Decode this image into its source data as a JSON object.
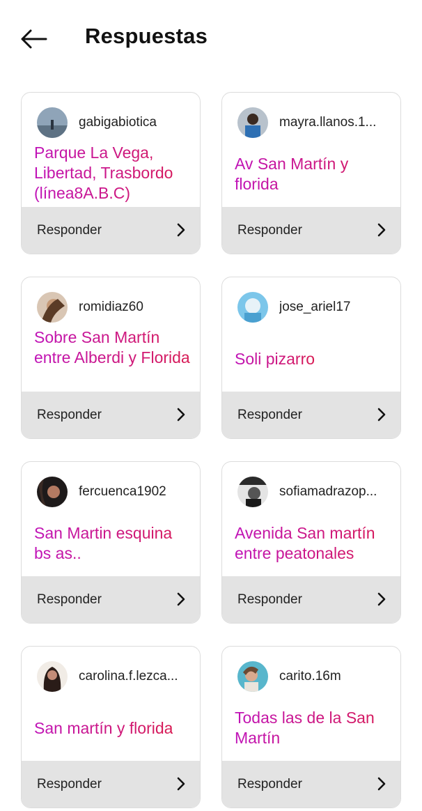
{
  "header": {
    "title": "Respuestas"
  },
  "reply_label": "Responder",
  "cards": [
    {
      "username": "gabigabiotica",
      "answer": "Parque La Vega, Libertad, Trasbordo (línea8A.B.C)"
    },
    {
      "username": "mayra.llanos.1...",
      "answer": "Av San Martín y florida"
    },
    {
      "username": "romidiaz60",
      "answer": "Sobre San Martín entre Alberdi y Florida"
    },
    {
      "username": "jose_ariel17",
      "answer": "Soli pizarro"
    },
    {
      "username": "fercuenca1902",
      "answer": "San Martin esquina bs as.."
    },
    {
      "username": "sofiamadrazop...",
      "answer": "Avenida San martín entre peatonales"
    },
    {
      "username": "carolina.f.lezca...",
      "answer": "San martín y florida"
    },
    {
      "username": "carito.16m",
      "answer": "Todas las de la San Martín"
    }
  ]
}
